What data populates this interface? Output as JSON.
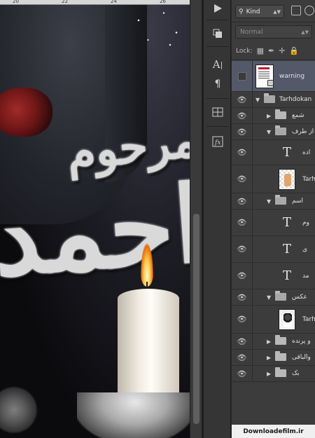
{
  "app": "Photoshop",
  "canvas": {
    "ruler_marks": [
      "20",
      "22",
      "24",
      "26"
    ],
    "calligraphy_top": "مرحوم",
    "calligraphy_main": "احمد"
  },
  "toolbar": {
    "tools": [
      "play-icon",
      "3d-layer-icon",
      "character-icon",
      "paragraph-icon",
      "grid-icon",
      "type-path-icon"
    ]
  },
  "layers_panel": {
    "filter_kind": "Kind",
    "blend_mode": "Normal",
    "lock_label": "Lock:",
    "layers": [
      {
        "name": "warning",
        "type": "smart",
        "visible": false,
        "selected": true
      },
      {
        "name": "Tarhdokan",
        "type": "group-open",
        "visible": true
      },
      {
        "name": "شمع",
        "type": "group-closed",
        "visible": true
      },
      {
        "name": "از طرف",
        "type": "group-open",
        "visible": true
      },
      {
        "name": "اده",
        "type": "text",
        "visible": true
      },
      {
        "name": "Tarh",
        "type": "image",
        "visible": true
      },
      {
        "name": "اسم",
        "type": "group-open",
        "visible": true
      },
      {
        "name": "وم",
        "type": "text",
        "visible": true
      },
      {
        "name": "ی",
        "type": "text",
        "visible": true
      },
      {
        "name": "مد",
        "type": "text",
        "visible": true
      },
      {
        "name": "عکس",
        "type": "group-open",
        "visible": true
      },
      {
        "name": "Tarh",
        "type": "photo",
        "visible": true
      },
      {
        "name": "و پرنده",
        "type": "group-closed",
        "visible": true
      },
      {
        "name": "والباقی",
        "type": "group-closed",
        "visible": true
      },
      {
        "name": "بک",
        "type": "group-closed",
        "visible": true
      }
    ]
  },
  "watermark": "Downloadefilm.ir"
}
